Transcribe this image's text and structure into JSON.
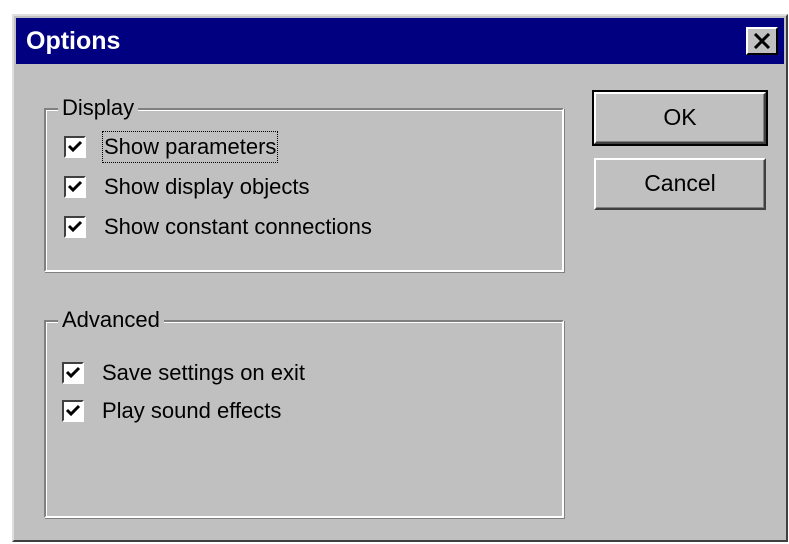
{
  "dialog": {
    "title": "Options",
    "close_icon": "close-icon"
  },
  "display_group": {
    "label": "Display",
    "items": [
      {
        "label": "Show parameters",
        "checked": true
      },
      {
        "label": "Show display objects",
        "checked": true
      },
      {
        "label": "Show constant connections",
        "checked": true
      }
    ]
  },
  "advanced_group": {
    "label": "Advanced",
    "items": [
      {
        "label": "Save settings on exit",
        "checked": true
      },
      {
        "label": "Play sound effects",
        "checked": true
      }
    ]
  },
  "buttons": {
    "ok_label": "OK",
    "cancel_label": "Cancel"
  },
  "colors": {
    "titlebar": "#000080",
    "face": "#c0c0c0"
  }
}
